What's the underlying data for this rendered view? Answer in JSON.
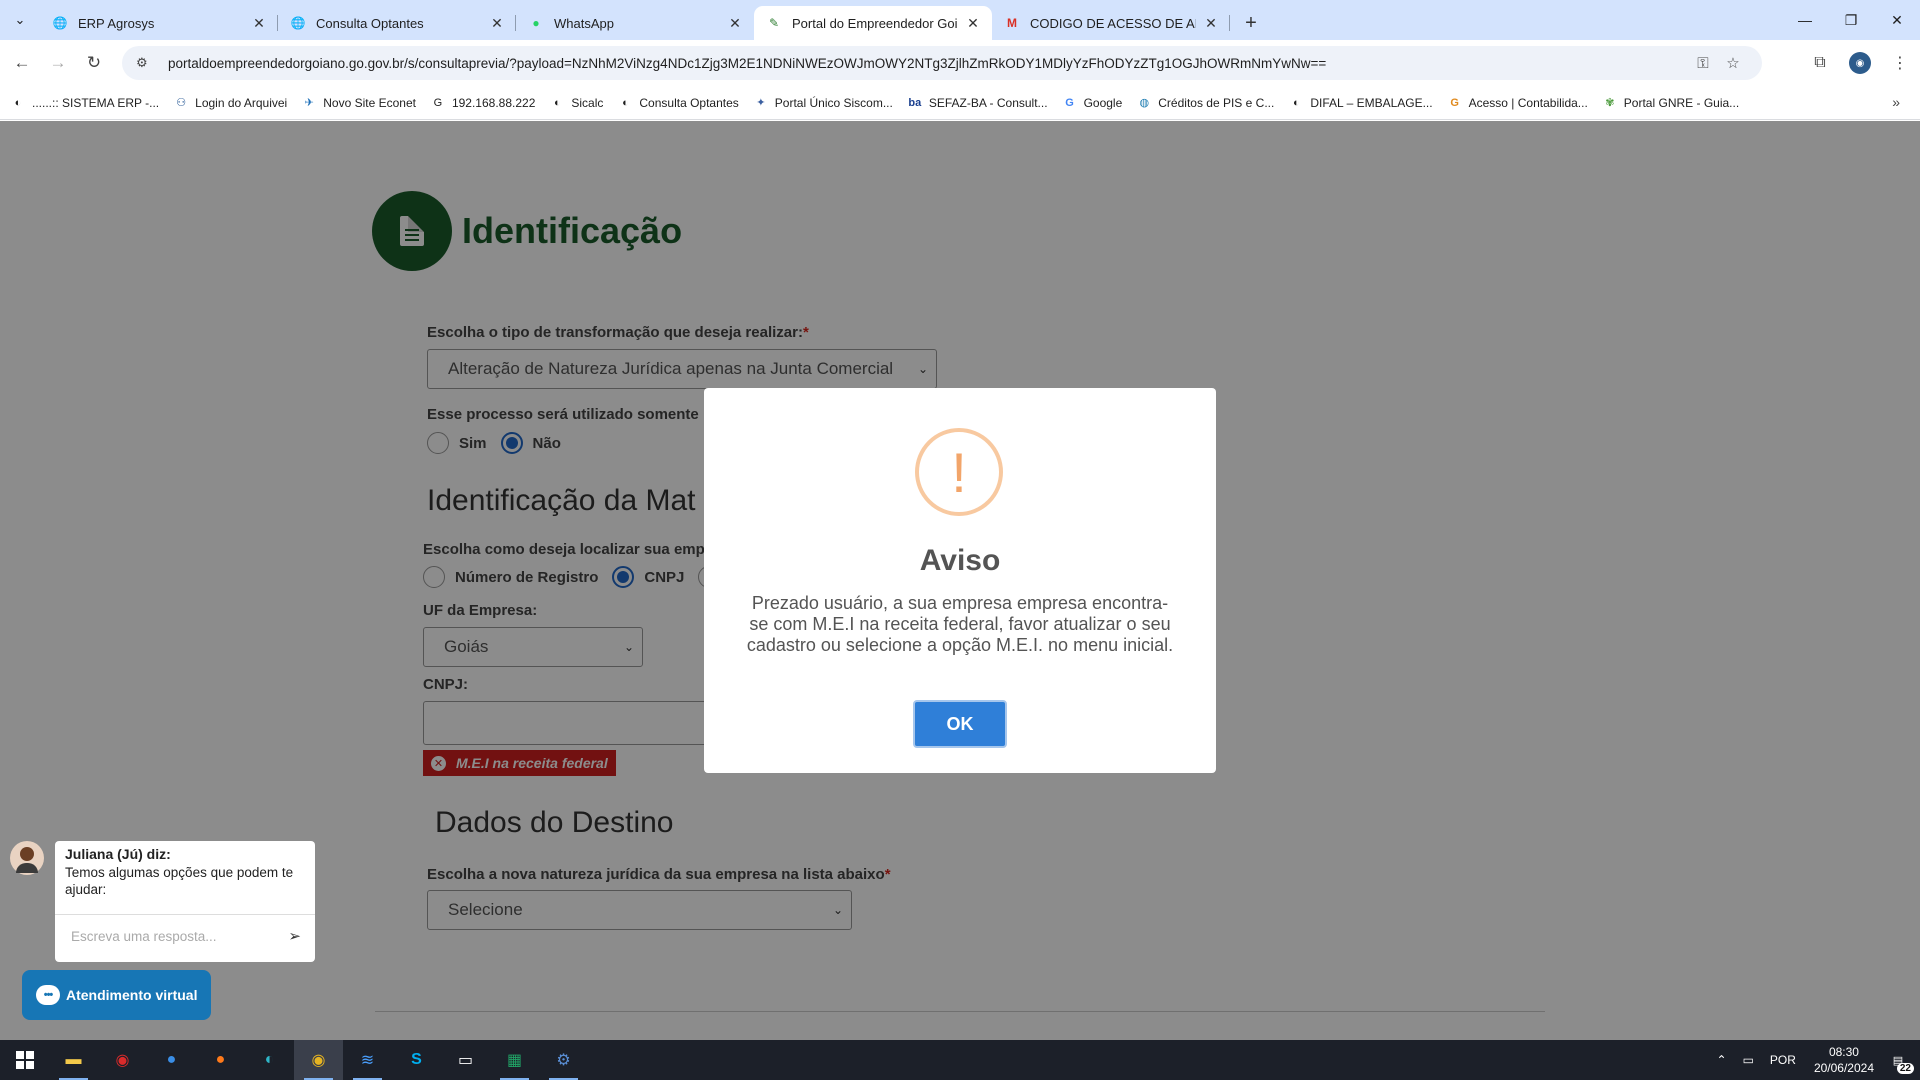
{
  "browser": {
    "tabs": [
      {
        "title": "ERP Agrosys",
        "icon": "globe-icon"
      },
      {
        "title": "Consulta Optantes",
        "icon": "globe-icon"
      },
      {
        "title": "WhatsApp",
        "icon": "whatsapp-icon"
      },
      {
        "title": "Portal do Empreendedor Goian",
        "icon": "portal-icon",
        "active": true
      },
      {
        "title": "CODIGO DE ACESSO DE ANA B",
        "icon": "gmail-icon"
      }
    ],
    "url": "portaldoempreendedorgoiano.go.gov.br/s/consultaprevia/?payload=NzNhM2ViNzg4NDc1Zjg3M2E1NDNiNWEzOWJmOWY2NTg3ZjlhZmRkODY1MDlyYzFhODYzZTg1OGJhOWRmNmYwNw==",
    "bookmarks": [
      "......:: SISTEMA ERP -...",
      "Login do Arquivei",
      "Novo Site Econet",
      "192.168.88.222",
      "Sicalc",
      "Consulta Optantes",
      "Portal Único Siscom...",
      "SEFAZ-BA - Consult...",
      "Google",
      "Créditos de PIS e C...",
      "DIFAL – EMBALAGE...",
      "Acesso | Contabilida...",
      "Portal GNRE - Guia..."
    ]
  },
  "form": {
    "title": "Identificação",
    "tipo_label": "Escolha o tipo de transformação que deseja realizar:",
    "required_mark": "*",
    "tipo_value": "Alteração de Natureza Jurídica apenas na Junta Comercial",
    "processo_label": "Esse processo será utilizado somente",
    "processo_options": [
      "Sim",
      "Não"
    ],
    "processo_selected": "Não",
    "section_matriz": "Identificação da Mat",
    "localizar_label": "Escolha como deseja localizar sua emp",
    "localizar_options": [
      "Número de Registro",
      "CNPJ"
    ],
    "localizar_selected": "CNPJ",
    "uf_label": "UF da Empresa:",
    "uf_value": "Goiás",
    "cnpj_label": "CNPJ:",
    "cnpj_value": "",
    "cnpj_error": "M.E.I na receita federal",
    "section_destino": "Dados do Destino",
    "natureza_label": "Escolha a nova natureza jurídica da sua empresa na lista abaixo",
    "natureza_value": "Selecione"
  },
  "modal": {
    "icon_glyph": "!",
    "title": "Aviso",
    "message": "Prezado usuário, a sua empresa empresa encontra-se com M.E.I na receita federal, favor atualizar o seu cadastro ou selecione a opção M.E.I. no menu inicial.",
    "ok_label": "OK"
  },
  "chat": {
    "agent_name": "Juliana (Jú) diz:",
    "message": "Temos algumas opções que podem te ajudar:",
    "input_placeholder": "Escreva uma resposta...",
    "button_label": "Atendimento virtual"
  },
  "taskbar": {
    "language": "POR",
    "time": "08:30",
    "date": "20/06/2024",
    "notifications": "22"
  }
}
